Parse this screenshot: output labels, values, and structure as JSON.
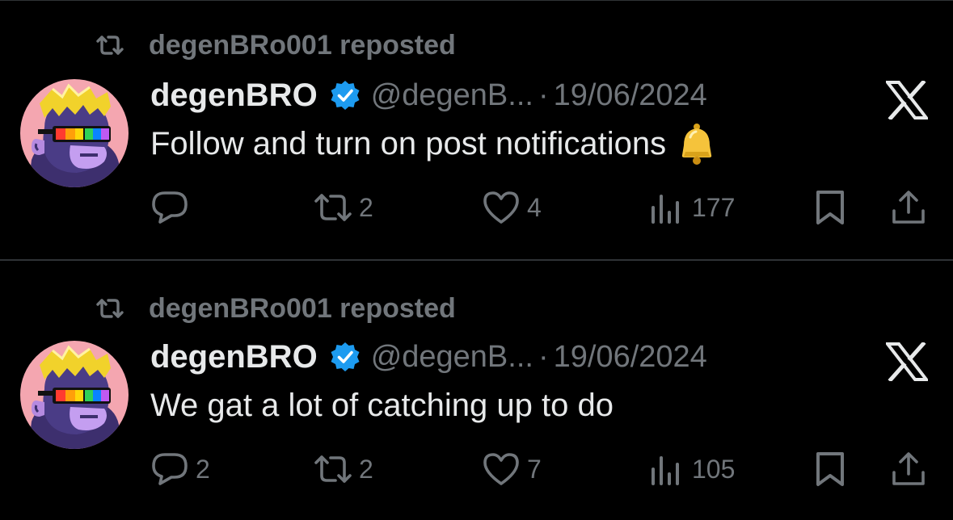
{
  "colors": {
    "background": "#000000",
    "text_primary": "#e7e9ea",
    "text_secondary": "#71767b",
    "divider": "#2f3336",
    "verified_blue": "#1d9bf0"
  },
  "icons": {
    "repost": "repost-icon",
    "verified": "verified-badge-icon",
    "platform": "x-logo-icon",
    "reply": "reply-icon",
    "like": "heart-icon",
    "views": "views-chart-icon",
    "bookmark": "bookmark-icon",
    "share": "share-icon",
    "bell": "bell-emoji"
  },
  "tweets": [
    {
      "repost_label": "degenBRo001 reposted",
      "display_name": "degenBRO",
      "handle": "@degenB...",
      "separator": "·",
      "date": "19/06/2024",
      "text": "Follow and turn on post  notifications",
      "has_bell_emoji": true,
      "stats": {
        "replies": "",
        "reposts": "2",
        "likes": "4",
        "views": "177"
      }
    },
    {
      "repost_label": "degenBRo001 reposted",
      "display_name": "degenBRO",
      "handle": "@degenB...",
      "separator": "·",
      "date": "19/06/2024",
      "text": "We gat a lot of catching up to do",
      "has_bell_emoji": false,
      "stats": {
        "replies": "2",
        "reposts": "2",
        "likes": "7",
        "views": "105"
      }
    }
  ]
}
